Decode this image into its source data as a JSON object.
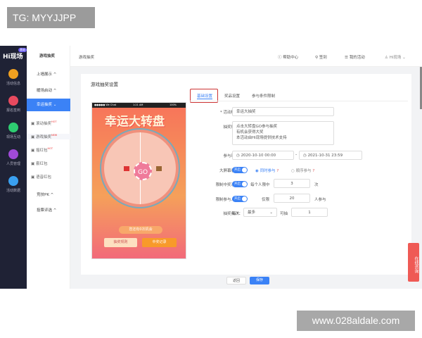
{
  "tag": "TG: MYYJJPP",
  "watermark": "www.028aldale.com",
  "logo": "Hi现场",
  "logo_badge": "基础",
  "nav": [
    {
      "label": "活动信息",
      "color": "#f0a020"
    },
    {
      "label": "报名签到",
      "color": "#e84a5f"
    },
    {
      "label": "现场互动",
      "color": "#2ecc71"
    },
    {
      "label": "人员管理",
      "color": "#a04ad8"
    },
    {
      "label": "活动数据",
      "color": "#3aa0f0"
    }
  ],
  "sub": {
    "title": "游戏抽奖",
    "groups": [
      "上墙展示",
      "暖场启动",
      "幸运抽奖"
    ],
    "items": [
      {
        "label": "滚动抽奖",
        "badge": "HOT"
      },
      {
        "label": "游戏抽奖",
        "badge": "NEW"
      },
      {
        "label": "摇红包",
        "badge": "HOT"
      },
      {
        "label": "套红包",
        "badge": ""
      },
      {
        "label": "语音红包",
        "badge": ""
      }
    ],
    "groups2": [
      "竞技PK",
      "投票评选"
    ]
  },
  "topbar": {
    "breadcrumb": "游戏抽奖",
    "help": "帮助中心",
    "sign": "签到",
    "my": "我的活动",
    "user": "Hi现场"
  },
  "card_title": "游戏抽奖设置",
  "phone": {
    "status_left": "●●●●● We Chat",
    "status_time": "1:21 AM",
    "status_right": "100%",
    "title": "幸运大转盘",
    "go": "GO",
    "chances": "您还有0次机会",
    "rules_btn": "抽奖规则",
    "records_btn": "中奖记录"
  },
  "tabs": [
    "基础设置",
    "奖品设置",
    "参与条件限制"
  ],
  "form": {
    "title_label": "* 活动标题：",
    "title_value": "幸运大抽奖",
    "rules_label": "抽奖规则：",
    "rules_lines": [
      "点击大转盘GO参与抽奖",
      "有机会获得大奖",
      "本活动由Hi现场提供技术支持"
    ],
    "time_label": "参与时间：",
    "start": "2020-10-10 00:00",
    "end": "2021-10-31 23:59",
    "screen_label": "大屏幕状态：",
    "switch_on": "开启",
    "opt1": "同时参与",
    "opt2": "顺序参与",
    "limit_label": "限制中奖次数：",
    "limit_pre": "每个人限中",
    "limit_val": "3",
    "limit_unit": "次",
    "people_label": "限制参与人数：",
    "people_pre": "仅限",
    "people_val": "20",
    "people_unit": "人参与",
    "freq_label": "抽奖频次：",
    "freq_pre": "每人",
    "freq_sel": "最多",
    "freq_mid": "可抽",
    "freq_val": "1"
  },
  "buttons": {
    "back": "返回",
    "save": "保存"
  },
  "float": "在线咨询"
}
